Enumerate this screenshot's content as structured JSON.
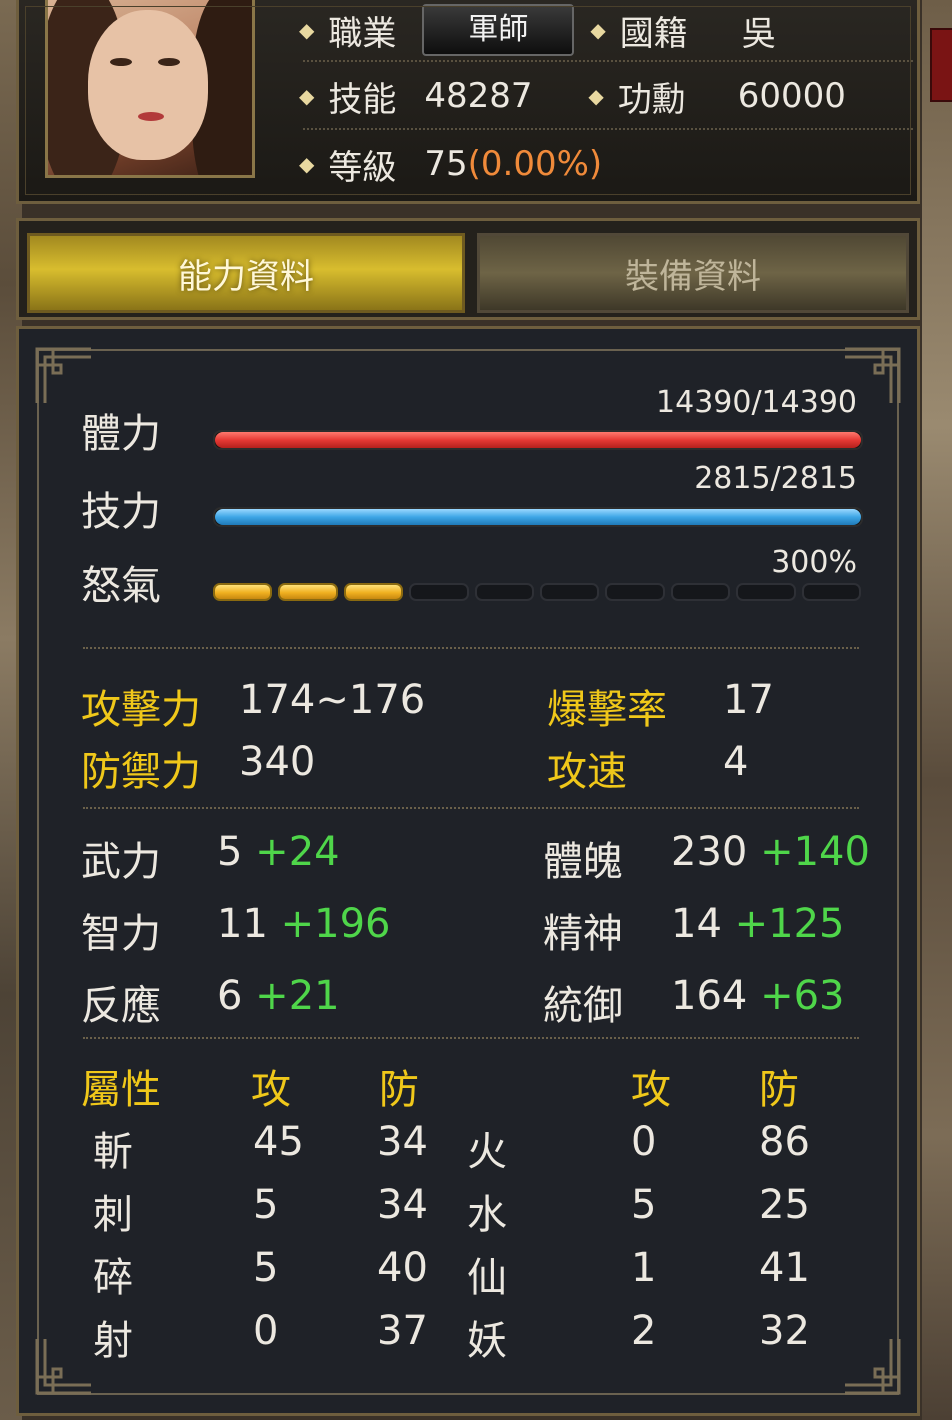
{
  "header": {
    "job_label": "職業",
    "job_value": "軍師",
    "nation_label": "國籍",
    "nation_value": "吳",
    "skill_label": "技能",
    "skill_value": "48287",
    "merit_label": "功勳",
    "merit_value": "60000",
    "level_label": "等級",
    "level_value": "75",
    "level_exp": "(0.00%)"
  },
  "tabs": [
    {
      "label": "能力資料",
      "active": true
    },
    {
      "label": "裝備資料",
      "active": false
    }
  ],
  "bars": {
    "hp": {
      "label": "體力",
      "value": "14390/14390",
      "fraction": 1.0
    },
    "mp": {
      "label": "技力",
      "value": "2815/2815",
      "fraction": 1.0
    },
    "rage": {
      "label": "怒氣",
      "value": "300%",
      "filled": 3,
      "total": 10
    }
  },
  "combat": {
    "attack_label": "攻擊力",
    "attack_value": "174~176",
    "crit_label": "爆擊率",
    "crit_value": "17",
    "defense_label": "防禦力",
    "defense_value": "340",
    "speed_label": "攻速",
    "speed_value": "4"
  },
  "attributes": [
    {
      "label": "武力",
      "base": "5",
      "bonus": "+24"
    },
    {
      "label": "體魄",
      "base": "230",
      "bonus": "+140"
    },
    {
      "label": "智力",
      "base": "11",
      "bonus": "+196"
    },
    {
      "label": "精神",
      "base": "14",
      "bonus": "+125"
    },
    {
      "label": "反應",
      "base": "6",
      "bonus": "+21"
    },
    {
      "label": "統御",
      "base": "164",
      "bonus": "+63"
    }
  ],
  "elements": {
    "header_label": "屬性",
    "atk_header": "攻",
    "def_header": "防",
    "atk_header2": "攻",
    "def_header2": "防",
    "rows": [
      {
        "a_name": "斬",
        "a_atk": "45",
        "a_def": "34",
        "b_name": "火",
        "b_atk": "0",
        "b_def": "86"
      },
      {
        "a_name": "刺",
        "a_atk": "5",
        "a_def": "34",
        "b_name": "水",
        "b_atk": "5",
        "b_def": "25"
      },
      {
        "a_name": "碎",
        "a_atk": "5",
        "a_def": "40",
        "b_name": "仙",
        "b_atk": "1",
        "b_def": "41"
      },
      {
        "a_name": "射",
        "a_atk": "0",
        "a_def": "37",
        "b_name": "妖",
        "b_atk": "2",
        "b_def": "32"
      }
    ]
  },
  "colors": {
    "gold": "#f0c81a",
    "green": "#4fd64a",
    "orange": "#f08a3a",
    "hp": "#e63a34",
    "mp": "#3ea6e6",
    "rage": "#f0b020"
  }
}
